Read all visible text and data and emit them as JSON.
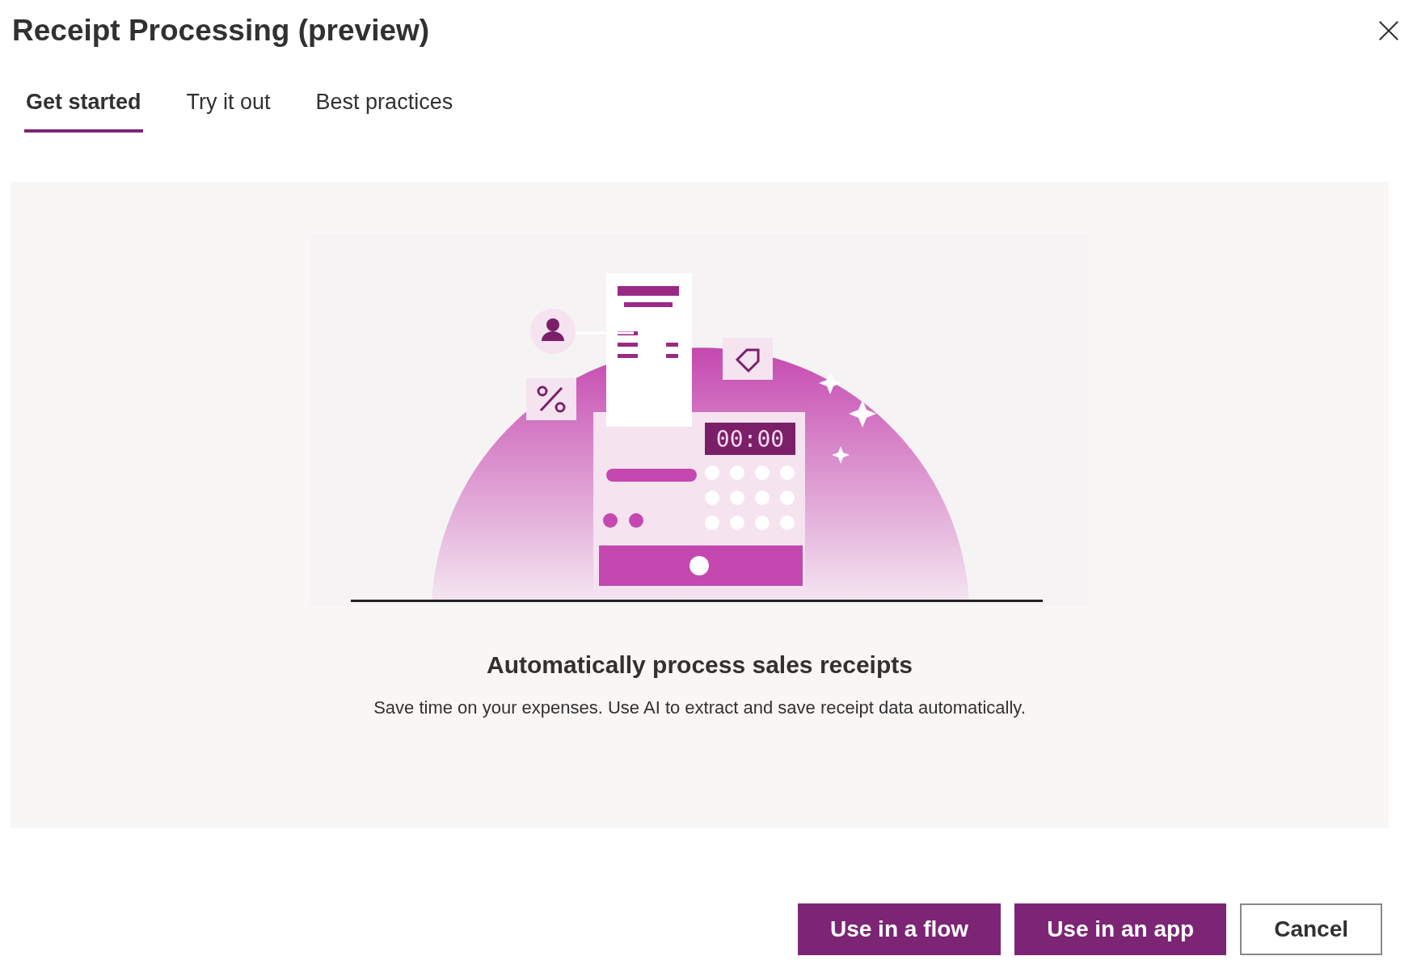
{
  "dialog": {
    "title": "Receipt Processing (preview)"
  },
  "tabs": [
    {
      "label": "Get started",
      "selected": true
    },
    {
      "label": "Try it out",
      "selected": false
    },
    {
      "label": "Best practices",
      "selected": false
    }
  ],
  "illustration": {
    "display": "00:00"
  },
  "heading": "Automatically process sales receipts",
  "description": "Save time on your expenses. Use AI to extract and save receipt data automatically.",
  "buttons": [
    {
      "label": "Use in a flow",
      "kind": "primary"
    },
    {
      "label": "Use in an app",
      "kind": "primary"
    },
    {
      "label": "Cancel",
      "kind": "secondary"
    }
  ]
}
